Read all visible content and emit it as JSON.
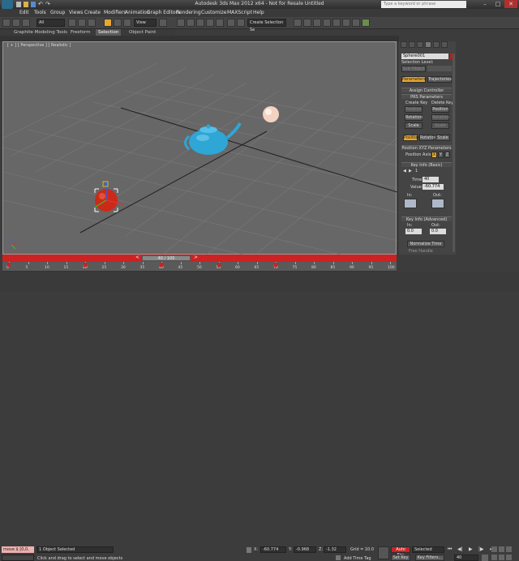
{
  "app": {
    "title": "Autodesk 3ds Max  2012 x64  -  Not for Resale    Untitled",
    "search_placeholder": "Type a keyword or phrase"
  },
  "menubar": [
    "Edit",
    "Tools",
    "Group",
    "Views",
    "Create",
    "Modifiers",
    "Animation",
    "Graph Editors",
    "Rendering",
    "Customize",
    "MAXScript",
    "Help"
  ],
  "toolbar": {
    "filter": "All",
    "refcoord": "View",
    "selection_set": "Create Selection Se"
  },
  "ribbon": {
    "tabs": [
      "Graphite Modeling Tools",
      "Freeform",
      "Selection",
      "Object Paint"
    ],
    "active_tab": "Selection"
  },
  "viewport": {
    "label": "[ + ] [ Perspective ] [ Realistic ]"
  },
  "command_panel": {
    "object_name": "Sphere001",
    "selection_level_label": "Selection Level:",
    "sub_object": "Sub-Object",
    "tabs": [
      "Parameters",
      "Trajectories"
    ],
    "active_tab": "Parameters",
    "rollout_assign": "Assign Controller",
    "rollout_prs": "PRS Parameters",
    "create_key": "Create Key",
    "delete_key": "Delete Key",
    "prs_buttons_left": [
      "Position",
      "Rotation",
      "Scale"
    ],
    "prs_buttons_right": [
      "Position",
      "Rotation",
      "Scale"
    ],
    "mode_tabs": [
      "Position",
      "Rotation",
      "Scale"
    ],
    "rollout_xyz": "Position XYZ Parameters",
    "position_axis_label": "Position Axis:",
    "axes": [
      "X",
      "Y",
      "Z"
    ],
    "rollout_keyinfo": "Key Info (Basic)",
    "key_number": "1",
    "time_label": "Time:",
    "time_value": "40",
    "value_label": "Value:",
    "value_value": "-60.774",
    "in_label": "In:",
    "out_label": "Out:",
    "rollout_keyinfo_adv": "Key Info (Advanced)",
    "adv_in": "In:",
    "adv_out": "Out:",
    "adv_in_value": "0.0",
    "adv_out_value": "0.0",
    "normalize_time": "Normalize Time",
    "free_handle": "Free Handle"
  },
  "timeslider": {
    "label": "40 / 100",
    "ticks": [
      "0",
      "5",
      "10",
      "15",
      "20",
      "25",
      "30",
      "35",
      "40",
      "45",
      "50",
      "55",
      "60",
      "65",
      "70",
      "75",
      "80",
      "85",
      "90",
      "95",
      "100"
    ],
    "key_frames": [
      0,
      20,
      40,
      55,
      70
    ]
  },
  "status": {
    "maxscript_text": "move $ [0,0,",
    "objects_selected": "1 Object Selected",
    "prompt": "Click and drag to select and move objects",
    "x_label": "X:",
    "x_value": "-60.774",
    "y_label": "Y:",
    "y_value": "-0.968",
    "z_label": "Z:",
    "z_value": "-1.32",
    "grid": "Grid = 10.0",
    "add_time_tag": "Add Time Tag",
    "auto_key": "Auto Key",
    "set_key": "Set Key",
    "selected_dropdown": "Selected",
    "key_filters": "Key Filters...",
    "current_frame": "40"
  },
  "colors": {
    "timeslider": "#cc2222",
    "autokey": "#cc2222",
    "active_accent": "#e7a82d",
    "teapot": "#2ea6d6",
    "sphere_red": "#cc2a18",
    "sphere_peach": "#f2d2c0",
    "viewport_bg": "#676767"
  }
}
